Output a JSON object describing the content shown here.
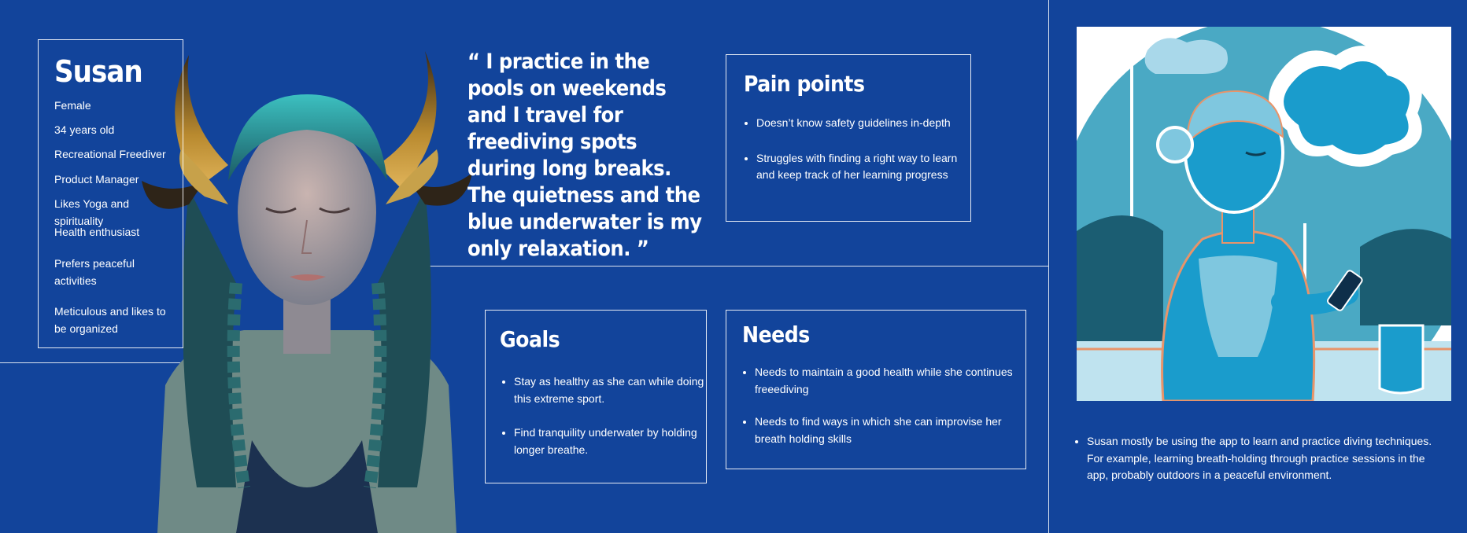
{
  "persona": {
    "name": "Susan",
    "attributes": [
      "Female",
      "34 years old",
      "Recreational Freediver",
      "Product Manager",
      "Likes Yoga and spirituality",
      "Health enthusiast",
      "Prefers peaceful activities",
      "Meticulous and likes to be organized"
    ]
  },
  "quote": "“ I practice in the pools on weekends and I travel for freediving spots during long breaks. The quietness and the blue underwater is my only relaxation. ”",
  "pain_points": {
    "title": "Pain points",
    "items": [
      "Doesn’t know safety guidelines in-depth",
      "Struggles with finding a right way to learn and keep track of her learning progress"
    ]
  },
  "goals": {
    "title": "Goals",
    "items": [
      "Stay as healthy as she can while doing this extreme sport.",
      "Find tranquility underwater by holding longer breathe."
    ]
  },
  "needs": {
    "title": "Needs",
    "items": [
      "Needs to maintain a good health while she continues freeediving",
      "Needs to find ways in which she can improvise her breath holding skills"
    ]
  },
  "scenario": "Susan mostly be using the app to learn and practice diving techniques. For example, learning breath-holding through practice sessions in the app, probably outdoors in a peaceful environment.",
  "colors": {
    "background": "#12449b",
    "text": "#ffffff",
    "illustration_cyan": "#1a9ccc",
    "illustration_orange": "#e8946a"
  }
}
